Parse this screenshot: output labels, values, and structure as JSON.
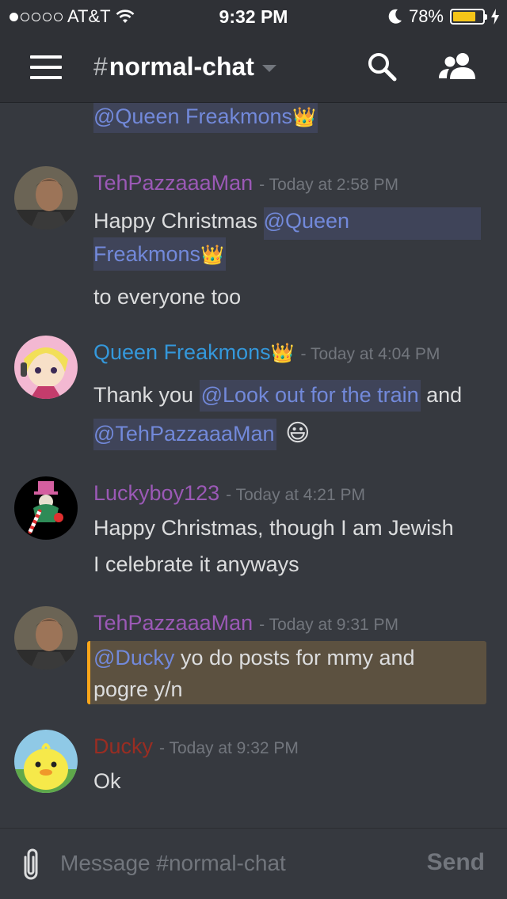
{
  "status_bar": {
    "carrier": "AT&T",
    "time": "9:32 PM",
    "battery": "78%",
    "battery_level": 0.78,
    "signal_bars_filled": 1,
    "signal_bars_total": 5
  },
  "header": {
    "channel_hash": "#",
    "channel_name": "normal-chat"
  },
  "messages": [
    {
      "continuation": true,
      "mention": "@Queen Freakmons",
      "emoji": "👑"
    },
    {
      "username": "TehPazzaaaMan",
      "timestamp": "- Today at 2:58 PM",
      "line1_text": "Happy Christmas ",
      "mention_part1": "@Queen",
      "mention_part2": "Freakmons",
      "emoji": "👑",
      "line3_text": "to everyone too"
    },
    {
      "username": "Queen Freakmons",
      "user_emoji": "👑",
      "timestamp": "- Today at 4:04 PM",
      "line1_text": "Thank you ",
      "mention1": "@Look out for the train",
      "line1_after": " and",
      "mention2": "@TehPazzaaaMan",
      "emoji": "😃"
    },
    {
      "username": "Luckyboy123",
      "timestamp": "- Today at 4:21 PM",
      "line1": "Happy Christmas, though I am Jewish",
      "line2": "I celebrate it anyways"
    },
    {
      "username": "TehPazzaaaMan",
      "timestamp": "- Today at 9:31 PM",
      "mention": "@Ducky",
      "line1_after": "  yo do posts for mmy and",
      "line2": "pogre  y/n"
    },
    {
      "username": "Ducky",
      "timestamp": "- Today at 9:32 PM",
      "line1": "Ok"
    }
  ],
  "composer": {
    "placeholder": "Message #normal-chat",
    "send_label": "Send"
  },
  "colors": {
    "background": "#36393f",
    "header": "#2f3136",
    "mention_text": "#7289da",
    "mention_bg": "#3f4459",
    "purple_user": "#9b59b6",
    "blue_user": "#3498db",
    "red_user": "#992d22",
    "quote_bar": "#faa61a",
    "quote_bg": "#5c5140",
    "battery": "#f5c518"
  },
  "icons": {
    "menu": "hamburger-icon",
    "search": "search-icon",
    "members": "members-icon",
    "attach": "paperclip-icon",
    "wifi": "wifi-icon",
    "moon": "moon-icon",
    "charging": "bolt-icon"
  }
}
